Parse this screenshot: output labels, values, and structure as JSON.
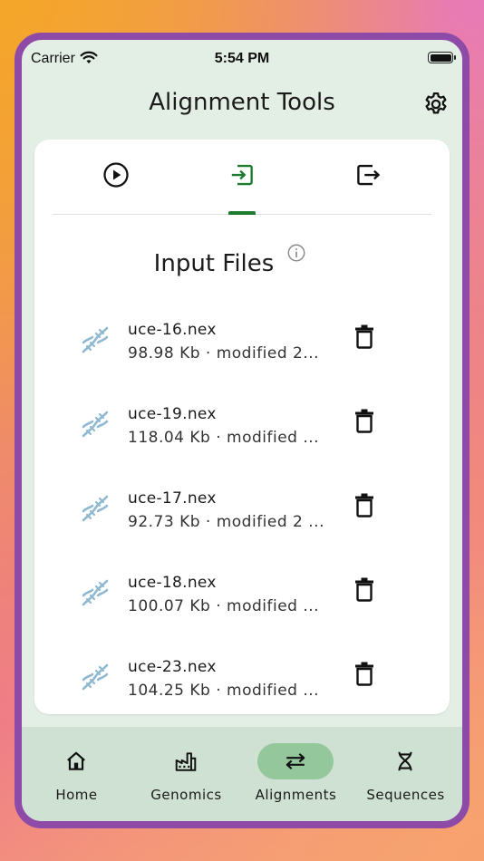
{
  "status_bar": {
    "carrier": "Carrier",
    "time": "5:54 PM"
  },
  "header": {
    "title": "Alignment Tools"
  },
  "tabs": [
    {
      "icon": "play-circle-icon"
    },
    {
      "icon": "input-icon",
      "active": true
    },
    {
      "icon": "output-icon"
    }
  ],
  "section": {
    "title": "Input Files"
  },
  "files": [
    {
      "name": "uce-16.nex",
      "meta": "98.98 Kb · modified 2..."
    },
    {
      "name": "uce-19.nex",
      "meta": "118.04 Kb · modified ..."
    },
    {
      "name": "uce-17.nex",
      "meta": "92.73 Kb · modified 2 ..."
    },
    {
      "name": "uce-18.nex",
      "meta": "100.07 Kb · modified ..."
    },
    {
      "name": "uce-23.nex",
      "meta": "104.25 Kb · modified ..."
    }
  ],
  "nav": [
    {
      "label": "Home",
      "icon": "home-icon"
    },
    {
      "label": "Genomics",
      "icon": "factory-icon"
    },
    {
      "label": "Alignments",
      "icon": "swap-icon",
      "active": true
    },
    {
      "label": "Sequences",
      "icon": "dna-icon"
    }
  ],
  "colors": {
    "accent": "#1e7a2f",
    "frame": "#8e4aa7",
    "surface": "#e3eee5",
    "nav": "#cfe1d2",
    "pill": "#95c79c"
  }
}
